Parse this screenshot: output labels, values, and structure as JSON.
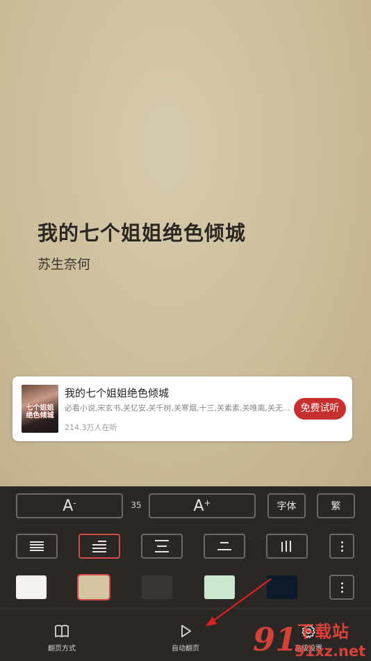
{
  "book": {
    "title": "我的七个姐姐绝色倾城",
    "author": "苏生奈何"
  },
  "audio_card": {
    "cover_text": "七个姐姐 绝色倾城",
    "title": "我的七个姐姐绝色倾城",
    "description": "必看小说,宋玄书,关忆安,关千树,关寒烟,十三,关素素,关唯离,关无...",
    "listeners": "214.3万人在听",
    "listen_button": "免费试听"
  },
  "settings_panel": {
    "font_decrease_label": "A",
    "font_decrease_mark": "-",
    "font_size_value": "35",
    "font_increase_label": "A",
    "font_increase_mark": "+",
    "font_button": "字体",
    "traditional_button": "繁",
    "line_spacing_options": [
      "compact",
      "normal",
      "loose",
      "wide",
      "vertical"
    ],
    "active_line_spacing": "normal",
    "background_colors": [
      "#f4f2ee",
      "#d5c4a2",
      "#3a3433",
      "#cde8d1",
      "#0c1a2a"
    ],
    "active_background": "#d5c4a2"
  },
  "bottom_nav": [
    {
      "label": "翻页方式",
      "icon": "book-icon"
    },
    {
      "label": "自动翻页",
      "icon": "play-icon"
    },
    {
      "label": "高级设置",
      "icon": "gear-icon"
    }
  ],
  "watermark": {
    "number": "91",
    "site": "下载站",
    "domain": "91xz.net"
  }
}
